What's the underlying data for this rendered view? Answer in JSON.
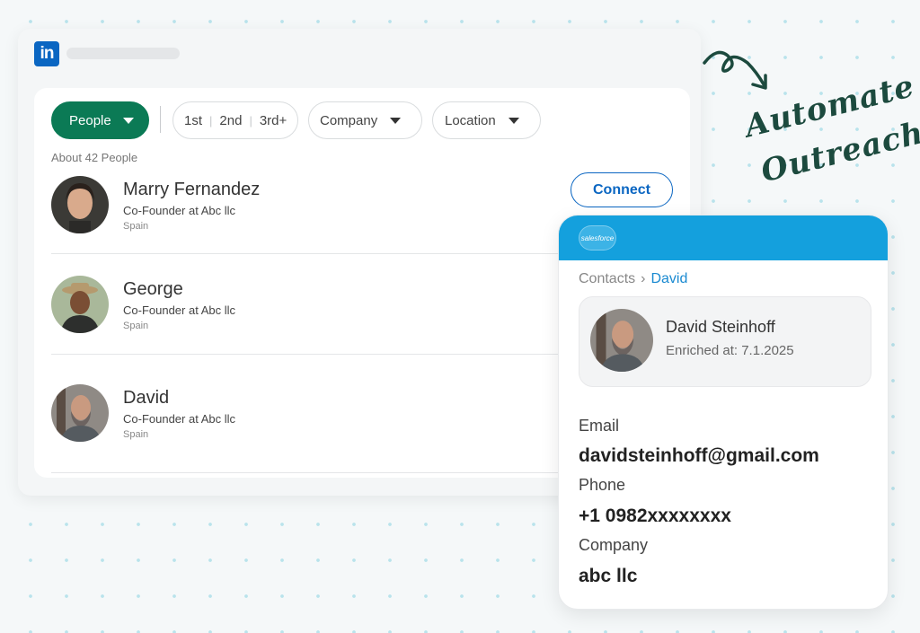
{
  "linkedin": {
    "logo_text": "in",
    "filters": {
      "people": "People",
      "degrees": [
        "1st",
        "2nd",
        "3rd+"
      ],
      "company": "Company",
      "location": "Location"
    },
    "result_count": "About 42 People",
    "connect_label": "Connect",
    "people": [
      {
        "name": "Marry Fernandez",
        "title": "Co-Founder at Abc llc",
        "location": "Spain"
      },
      {
        "name": "George",
        "title": "Co-Founder at Abc llc",
        "location": "Spain"
      },
      {
        "name": "David",
        "title": "Co-Founder at Abc llc",
        "location": "Spain"
      }
    ]
  },
  "headline": {
    "line1": "Automate",
    "line2": "Outreach"
  },
  "salesforce": {
    "logo_text": "salesforce",
    "breadcrumb": {
      "parent": "Contacts",
      "current": "David"
    },
    "contact": {
      "name": "David Steinhoff",
      "enriched": "Enriched at: 7.1.2025"
    },
    "fields": [
      {
        "label": "Email",
        "value": "davidsteinhoff@gmail.com"
      },
      {
        "label": "Phone",
        "value": "+1 0982xxxxxxxx"
      },
      {
        "label": "Company",
        "value": "abc llc"
      }
    ]
  },
  "colors": {
    "linkedin_blue": "#0a66c2",
    "people_green": "#0b7a55",
    "salesforce_blue": "#14a0dd",
    "headline_green": "#1c4a3e"
  }
}
